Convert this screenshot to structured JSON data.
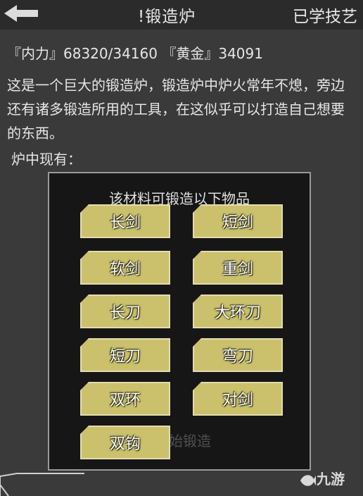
{
  "header": {
    "title": "锻造炉",
    "title_marker": "!",
    "right_tab": "已学技艺",
    "back_icon": "back-arrow-icon"
  },
  "stats": {
    "neili_label": "『内力』",
    "neili_value": "68320/34160",
    "gold_label": "『黄金』",
    "gold_value": "34091"
  },
  "description": "这是一个巨大的锻造炉，锻造炉中炉火常年不熄，旁边还有诸多锻造所用的工具，在这似乎可以打造自己想要的东西。",
  "furnace_label": "炉中现有：",
  "modal": {
    "title": "该材料可锻造以下物品",
    "items": [
      "长剑",
      "短剑",
      "软剑",
      "重剑",
      "长刀",
      "大环刀",
      "短刀",
      "弯刀",
      "双环",
      "对剑",
      "双钩"
    ],
    "background_partial_text": "开始锻造"
  },
  "watermark": "九游",
  "colors": {
    "background": "#3a3a3a",
    "item_button": "#cbc16c",
    "modal_background": "#161616"
  }
}
